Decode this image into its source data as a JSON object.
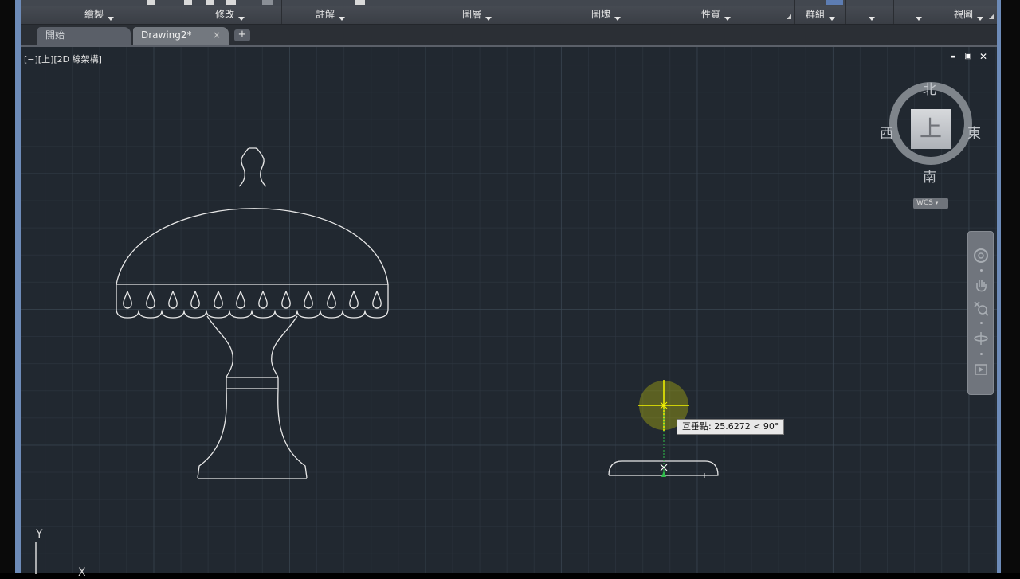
{
  "ribbon": {
    "panels": [
      {
        "label": "繪製",
        "has_caret": true,
        "launcher": false
      },
      {
        "label": "修改",
        "has_caret": true,
        "launcher": false
      },
      {
        "label": "註解",
        "has_caret": true,
        "launcher": false
      },
      {
        "label": "圖層",
        "has_caret": true,
        "launcher": false
      },
      {
        "label": "圖塊",
        "has_caret": true,
        "launcher": false
      },
      {
        "label": "性質",
        "has_caret": true,
        "launcher": true
      },
      {
        "label": "群組",
        "has_caret": true,
        "launcher": false
      },
      {
        "label": "",
        "has_caret": true,
        "launcher": false
      },
      {
        "label": "",
        "has_caret": true,
        "launcher": false
      },
      {
        "label": "視圖",
        "has_caret": true,
        "launcher": true
      }
    ]
  },
  "tabs": {
    "start_label": "開始",
    "drawing_label": "Drawing2*",
    "close_glyph": "×",
    "add_glyph": "+"
  },
  "viewport": {
    "label": "[−][上][2D 線架構]",
    "minimize_glyph": "▬",
    "restore_glyph": "▣",
    "close_glyph": "✕"
  },
  "viewcube": {
    "north": "北",
    "south": "南",
    "east": "東",
    "west": "西",
    "face": "上",
    "wcs_label": "WCS"
  },
  "navbar": {
    "icons": [
      "steering-wheel-icon",
      "pan-hand-icon",
      "zoom-icon",
      "orbit-icon",
      "showmotion-icon"
    ]
  },
  "ucs": {
    "y_label": "Y",
    "x_label": "X"
  },
  "osnap_tooltip": {
    "text": "互垂點: 25.6272 < 90°"
  },
  "colors": {
    "canvas_bg": "#212830",
    "grid_major": "#3c4854",
    "ribbon_bg": "#3f444b",
    "geometry": "#e8e8e8",
    "snap_marker": "#f5f500",
    "tracking_line": "#2fbf4a"
  }
}
